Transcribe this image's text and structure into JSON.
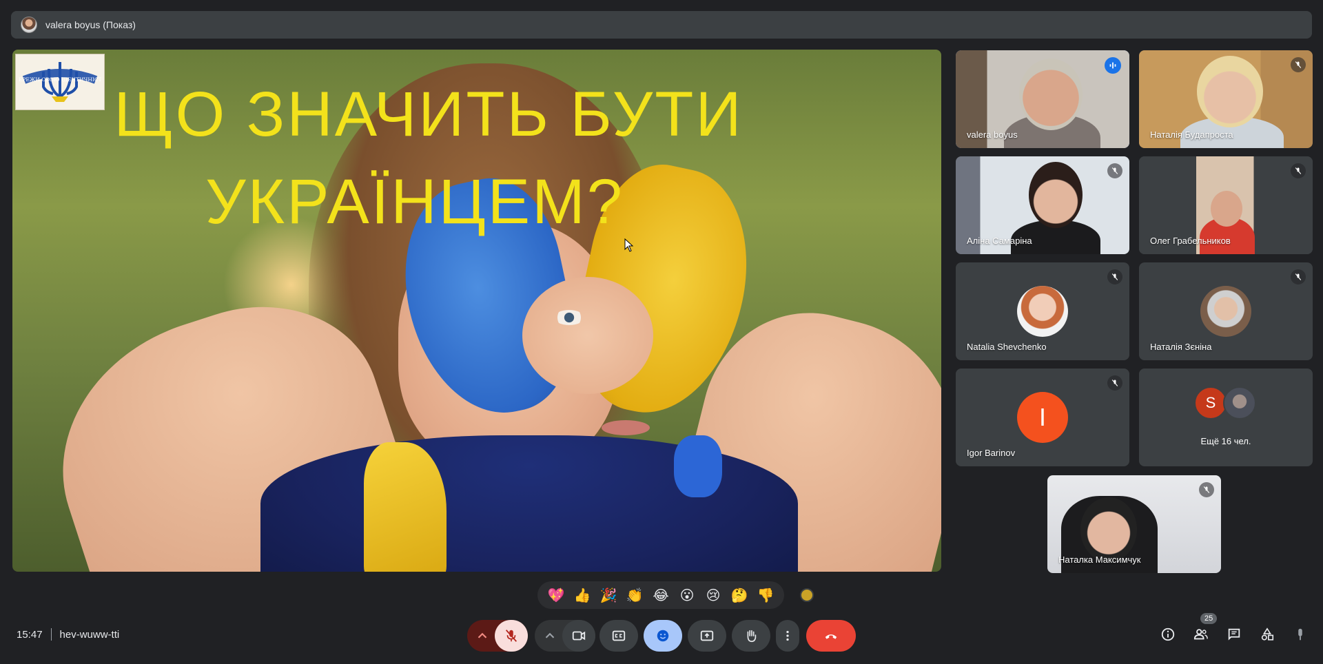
{
  "presenter": {
    "name": "valera boyus (Показ)"
  },
  "slide": {
    "title_line1": "ЩО ЗНАЧИТЬ БУТИ",
    "title_line2": "УКРАЇНЦЕМ?",
    "logo_text": "БЕРЕЖИ СВОЮ ІДЕНТИЧНІСТЬ"
  },
  "participants": [
    {
      "name": "valera boyus",
      "speaking": true
    },
    {
      "name": "Наталія Будапроста",
      "muted": true
    },
    {
      "name": "Аліна Самаріна",
      "muted": true
    },
    {
      "name": "Олег Грабельников",
      "muted": true
    },
    {
      "name": "Natalia Shevchenko",
      "muted": true
    },
    {
      "name": "Наталія Зєніна",
      "muted": true
    },
    {
      "name": "Igor Barinov",
      "initial": "I",
      "muted": true
    },
    {
      "more_initial": "S",
      "label": "Ещё 16 чел."
    },
    {
      "name": "Наталка Максимчук",
      "muted": true
    }
  ],
  "reactions": [
    "💖",
    "👍",
    "🎉",
    "👏",
    "😂",
    "😮",
    "😢",
    "🤔",
    "👎"
  ],
  "meeting": {
    "time": "15:47",
    "code": "hev-wuww-tti"
  },
  "people_count": "25",
  "colors": {
    "bg": "#202124",
    "tile": "#3c4043",
    "end_call": "#ea4335",
    "mic_off": "#f9dedc",
    "mic_group": "#5c1a16",
    "emoji_active": "#a8c7fa",
    "speaking": "#1a73e8",
    "slide_title": "#f3e21b"
  }
}
